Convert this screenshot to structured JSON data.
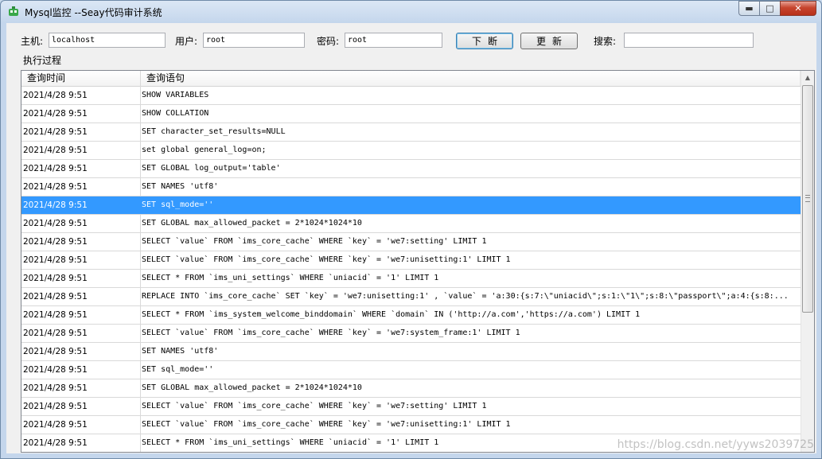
{
  "window": {
    "title": "Mysql监控 --Seay代码审计系统",
    "minimize_glyph": "▬",
    "maximize_glyph": "□",
    "close_glyph": "✕"
  },
  "toolbar": {
    "host_label": "主机:",
    "host_value": "localhost",
    "user_label": "用户:",
    "user_value": "root",
    "password_label": "密码:",
    "password_value": "root",
    "disconnect_label": "下断",
    "update_label": "更新",
    "search_label": "搜索:",
    "search_value": ""
  },
  "group": {
    "label": "执行过程"
  },
  "table": {
    "columns": [
      "查询时间",
      "查询语句"
    ],
    "selected_index": 6,
    "rows": [
      {
        "time": "2021/4/28 9:51",
        "query": "SHOW VARIABLES"
      },
      {
        "time": "2021/4/28 9:51",
        "query": "SHOW COLLATION"
      },
      {
        "time": "2021/4/28 9:51",
        "query": "SET character_set_results=NULL"
      },
      {
        "time": "2021/4/28 9:51",
        "query": "set global general_log=on;"
      },
      {
        "time": "2021/4/28 9:51",
        "query": "SET GLOBAL log_output='table'"
      },
      {
        "time": "2021/4/28 9:51",
        "query": "SET NAMES 'utf8'"
      },
      {
        "time": "2021/4/28 9:51",
        "query": "SET sql_mode=''"
      },
      {
        "time": "2021/4/28 9:51",
        "query": "SET GLOBAL max_allowed_packet = 2*1024*1024*10"
      },
      {
        "time": "2021/4/28 9:51",
        "query": "SELECT `value` FROM `ims_core_cache` WHERE `key` = 'we7:setting'  LIMIT 1"
      },
      {
        "time": "2021/4/28 9:51",
        "query": "SELECT `value` FROM `ims_core_cache` WHERE `key` = 'we7:unisetting:1'  LIMIT 1"
      },
      {
        "time": "2021/4/28 9:51",
        "query": "SELECT * FROM `ims_uni_settings` WHERE `uniacid` = '1'  LIMIT 1"
      },
      {
        "time": "2021/4/28 9:51",
        "query": "REPLACE INTO `ims_core_cache` SET `key` = 'we7:unisetting:1' , `value` = 'a:30:{s:7:\\\"uniacid\\\";s:1:\\\"1\\\";s:8:\\\"passport\\\";a:4:{s:8:..."
      },
      {
        "time": "2021/4/28 9:51",
        "query": "SELECT * FROM `ims_system_welcome_binddomain` WHERE `domain` IN ('http://a.com','https://a.com')  LIMIT 1"
      },
      {
        "time": "2021/4/28 9:51",
        "query": "SELECT `value` FROM `ims_core_cache` WHERE `key` = 'we7:system_frame:1'  LIMIT 1"
      },
      {
        "time": "2021/4/28 9:51",
        "query": "SET NAMES 'utf8'"
      },
      {
        "time": "2021/4/28 9:51",
        "query": "SET sql_mode=''"
      },
      {
        "time": "2021/4/28 9:51",
        "query": "SET GLOBAL max_allowed_packet = 2*1024*1024*10"
      },
      {
        "time": "2021/4/28 9:51",
        "query": "SELECT `value` FROM `ims_core_cache` WHERE `key` = 'we7:setting'  LIMIT 1"
      },
      {
        "time": "2021/4/28 9:51",
        "query": "SELECT `value` FROM `ims_core_cache` WHERE `key` = 'we7:unisetting:1'  LIMIT 1"
      },
      {
        "time": "2021/4/28 9:51",
        "query": "SELECT * FROM `ims_uni_settings` WHERE `uniacid` = '1'  LIMIT 1"
      }
    ]
  },
  "watermark": "https://blog.csdn.net/yyws2039725",
  "colors": {
    "selection": "#3399ff",
    "close_button": "#c6452e"
  }
}
